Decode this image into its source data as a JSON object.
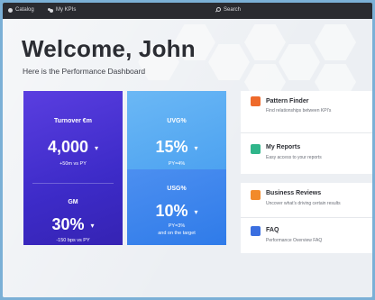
{
  "topbar": {
    "catalog": "Catalog",
    "kpis": "My KPIs",
    "search": "Search"
  },
  "header": {
    "title": "Welcome, John",
    "subtitle": "Here is the Performance Dashboard"
  },
  "kpis": {
    "turnover": {
      "label": "Turnover €m",
      "value": "4,000",
      "sub": "+50m vs PY"
    },
    "gm": {
      "label": "GM",
      "value": "30%",
      "sub": "-150 bps vs PY"
    },
    "uvg": {
      "label": "UVG%",
      "value": "15%",
      "sub": "PY=4%"
    },
    "usg": {
      "label": "USG%",
      "value": "10%",
      "sub": "PY=3%",
      "sub2": "and on the target"
    }
  },
  "side_panel": {
    "pattern_finder": {
      "title": "Pattern Finder",
      "subtitle": "Find relationships between KPI's"
    },
    "my_reports": {
      "title": "My Reports",
      "subtitle": "Easy access to your reports"
    },
    "business_reviews": {
      "title": "Business Reviews",
      "subtitle": "Uncover what's driving certain results"
    },
    "faq": {
      "title": "FAQ",
      "subtitle": "Performance Overview FAQ"
    }
  },
  "colors": {
    "turnover_card": "#4330d2",
    "uvg_card": "#5aaaf2",
    "usg_card": "#3a86ec",
    "pattern_icon": "#ee6a2b",
    "reports_icon": "#2fb58a",
    "reviews_icon": "#f28a2a",
    "faq_icon": "#3b6fe0"
  },
  "icons": {
    "catalog": "circle-icon",
    "kpis": "people-icon",
    "search": "search-icon",
    "pattern_finder": "flame-icon",
    "my_reports": "report-icon",
    "business_reviews": "bar-chart-icon",
    "faq": "warning-icon"
  }
}
